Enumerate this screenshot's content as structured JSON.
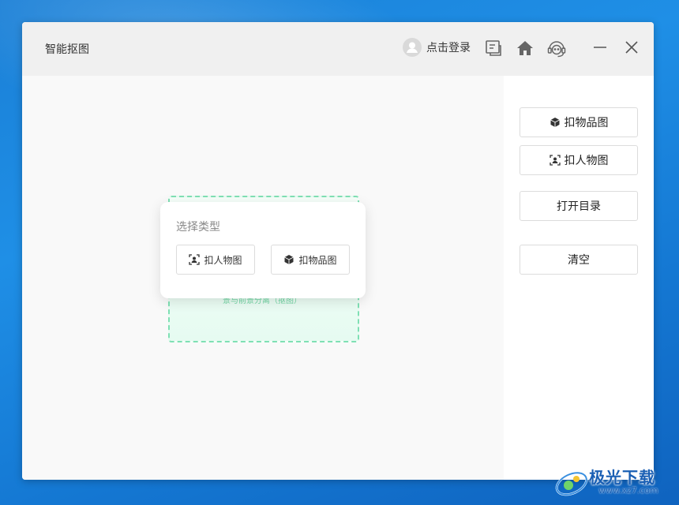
{
  "window": {
    "title": "智能抠图",
    "login_label": "点击登录"
  },
  "toolbar_icons": [
    "user-avatar-icon",
    "feedback-icon",
    "home-icon",
    "support-icon",
    "minimize-icon",
    "close-icon"
  ],
  "sidebar": {
    "product_button": "扣物品图",
    "person_button": "扣人物图",
    "open_dir_button": "打开目录",
    "clear_button": "清空"
  },
  "dropzone": {
    "hint": "景与前景分离（抠图）"
  },
  "popup": {
    "title": "选择类型",
    "person_button": "扣人物图",
    "product_button": "扣物品图"
  },
  "watermark": {
    "brand": "极光下载",
    "url": "www.xz7.com"
  },
  "colors": {
    "accent_green": "#7fe0b4",
    "brand_blue": "#1a5fb4"
  }
}
